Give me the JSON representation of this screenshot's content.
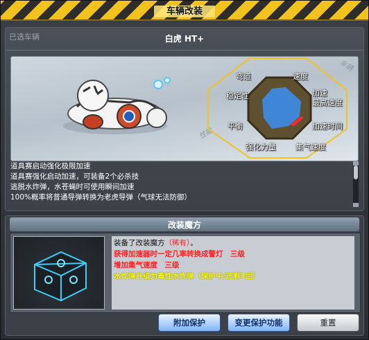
{
  "window": {
    "title": "车辆改装"
  },
  "selected_car": {
    "section_label": "已选车辆",
    "name": "白虎 HT+"
  },
  "preview": {
    "deco_top": "车辆",
    "deco_bottom": "性能"
  },
  "stats": {
    "labels": {
      "curve": "弯道",
      "speed": "速度",
      "accel": "加速",
      "max_speed": "最高速度",
      "accel_time": "加速时间",
      "gas_speed": "集气速度",
      "boost_power": "强化力量",
      "balance": "平衡",
      "stability": "稳定性"
    },
    "accent": "#ff2a2a",
    "fill": "#3f86d6"
  },
  "description": [
    "道具赛启动强化极限加速",
    "道具赛强化启动加速，可装备2个必杀技",
    "逃脱水炸弹，水苍蝇时可使用瞬间加速",
    "100%概率将普通导弹转换为老虎导弹（气球无法防御）"
  ],
  "mod": {
    "title": "改装魔方",
    "equipped_prefix": "装备了改装魔方",
    "rarity": "（稀有）",
    "rarity_end": "。",
    "line1": "获得加速器时一定几率转换成警灯　三级",
    "line2": "增加集气速度　三级",
    "line3": "水炸弹升级为毒性水炸弹（保护中/还剩3回）",
    "colors": {
      "red": "#ff2222",
      "yellow": "#ffff00"
    }
  },
  "buttons": {
    "protect": "附加保护",
    "change_protect": "变更保护功能",
    "reset": "重置"
  }
}
